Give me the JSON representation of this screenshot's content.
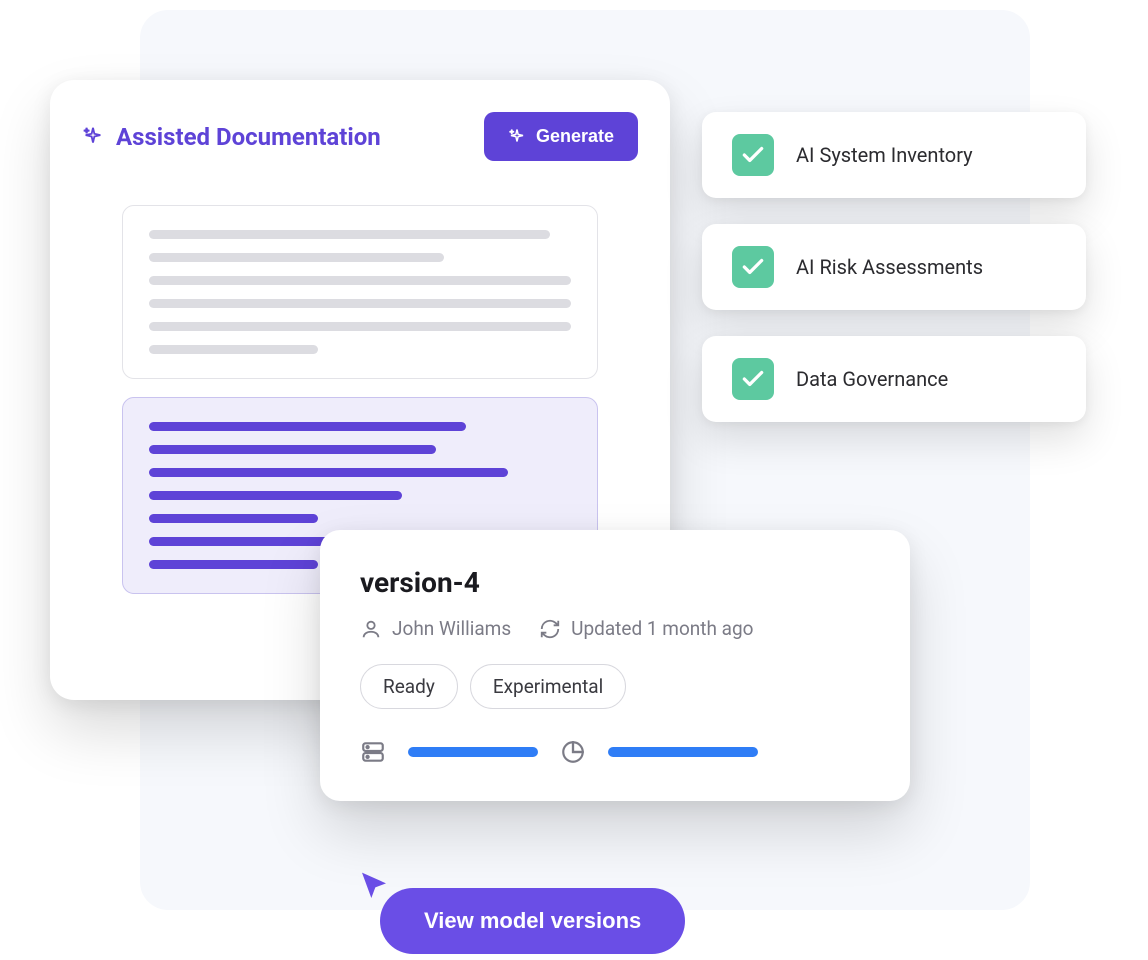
{
  "doc": {
    "title": "Assisted Documentation",
    "generate_label": "Generate"
  },
  "checks": [
    {
      "label": "AI System Inventory"
    },
    {
      "label": "AI Risk Assessments"
    },
    {
      "label": "Data Governance"
    }
  ],
  "version": {
    "name": "version-4",
    "author": "John Williams",
    "updated": "Updated 1 month ago",
    "tags": [
      "Ready",
      "Experimental"
    ]
  },
  "view_button": "View model versions"
}
